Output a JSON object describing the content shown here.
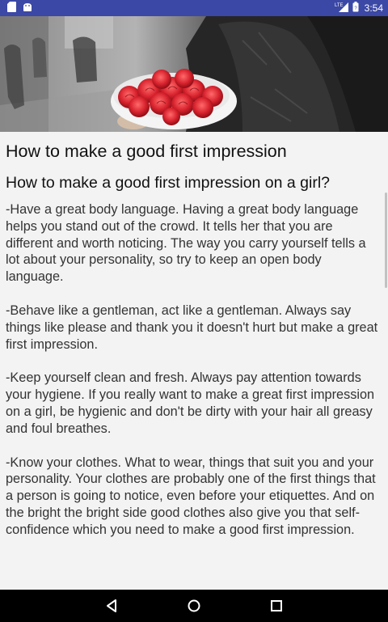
{
  "status_bar": {
    "time": "3:54",
    "network_label": "LTE",
    "icons": [
      "sd-card-icon",
      "android-icon",
      "lte-signal-icon",
      "battery-icon"
    ]
  },
  "hero": {
    "icon": "bouquet-of-roses-image"
  },
  "article": {
    "title": "How to make a good first impression",
    "subtitle": "How to make a good first impression on a girl?",
    "paragraphs": [
      "-Have a great body language. Having a great body language helps you stand out of the crowd. It tells her that you are different and worth noticing. The way you carry yourself tells a lot about your personality, so try to keep an open body language.",
      "-Behave like a gentleman, act like a gentleman. Always say things like please and thank you it doesn't hurt but make a great first impression.",
      "-Keep yourself clean and fresh. Always pay attention towards your hygiene. If you really want to make a great first impression on a girl, be hygienic and don't be dirty with your hair all greasy and foul breathes.",
      "-Know your clothes. What to wear, things that suit you and your personality. Your clothes are probably one of the first things that a person is going to notice, even before your etiquettes. And on the bright the bright side good clothes also give you that self-confidence which you need to make a good first impression."
    ]
  },
  "nav_bar": {
    "icons": [
      "back-icon",
      "home-icon",
      "recents-icon"
    ]
  },
  "colors": {
    "status_bar": "#3b48a5",
    "background": "#f3f3f3",
    "text": "#333333",
    "title": "#111111",
    "roses": "#d8232e"
  }
}
